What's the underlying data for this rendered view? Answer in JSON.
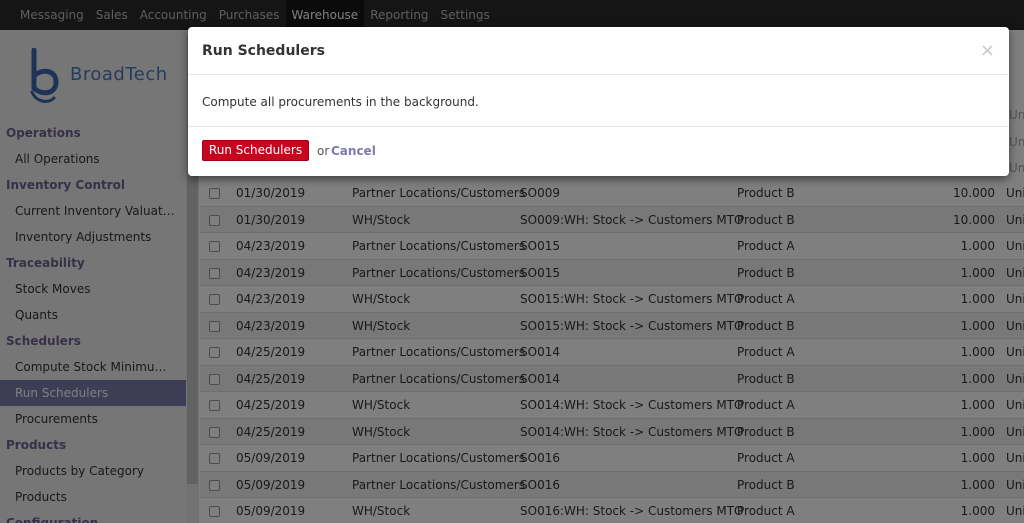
{
  "topbar": {
    "menus": [
      "Messaging",
      "Sales",
      "Accounting",
      "Purchases",
      "Warehouse",
      "Reporting",
      "Settings"
    ],
    "active": "Warehouse"
  },
  "logo": {
    "text": "BroadTech"
  },
  "sidebar": {
    "sections": [
      {
        "title": "Operations",
        "items": [
          "All Operations"
        ]
      },
      {
        "title": "Inventory Control",
        "items": [
          "Current Inventory Valuat…",
          "Inventory Adjustments"
        ]
      },
      {
        "title": "Traceability",
        "items": [
          "Stock Moves",
          "Quants"
        ]
      },
      {
        "title": "Schedulers",
        "items": [
          "Compute Stock Minimu…",
          "Run Schedulers",
          "Procurements"
        ]
      },
      {
        "title": "Products",
        "items": [
          "Products by Category",
          "Products"
        ]
      },
      {
        "title": "Configuration",
        "items": []
      }
    ],
    "active_item": "Run Schedulers"
  },
  "table": {
    "rows": [
      {
        "date": "01/30/2019",
        "location": "Partner Locations/Customers",
        "reference": "SO009",
        "product": "Product B",
        "qty": "10.000",
        "unit": "Uni"
      },
      {
        "date": "01/30/2019",
        "location": "WH/Stock",
        "reference": "SO009:WH: Stock -> Customers MTO",
        "product": "Product B",
        "qty": "10.000",
        "unit": "Uni"
      },
      {
        "date": "04/23/2019",
        "location": "Partner Locations/Customers",
        "reference": "SO015",
        "product": "Product A",
        "qty": "1.000",
        "unit": "Uni"
      },
      {
        "date": "04/23/2019",
        "location": "Partner Locations/Customers",
        "reference": "SO015",
        "product": "Product B",
        "qty": "1.000",
        "unit": "Uni"
      },
      {
        "date": "04/23/2019",
        "location": "WH/Stock",
        "reference": "SO015:WH: Stock -> Customers MTO",
        "product": "Product A",
        "qty": "1.000",
        "unit": "Uni"
      },
      {
        "date": "04/23/2019",
        "location": "WH/Stock",
        "reference": "SO015:WH: Stock -> Customers MTO",
        "product": "Product B",
        "qty": "1.000",
        "unit": "Uni"
      },
      {
        "date": "04/25/2019",
        "location": "Partner Locations/Customers",
        "reference": "SO014",
        "product": "Product A",
        "qty": "1.000",
        "unit": "Uni"
      },
      {
        "date": "04/25/2019",
        "location": "Partner Locations/Customers",
        "reference": "SO014",
        "product": "Product B",
        "qty": "1.000",
        "unit": "Uni"
      },
      {
        "date": "04/25/2019",
        "location": "WH/Stock",
        "reference": "SO014:WH: Stock -> Customers MTO",
        "product": "Product A",
        "qty": "1.000",
        "unit": "Uni"
      },
      {
        "date": "04/25/2019",
        "location": "WH/Stock",
        "reference": "SO014:WH: Stock -> Customers MTO",
        "product": "Product B",
        "qty": "1.000",
        "unit": "Uni"
      },
      {
        "date": "05/09/2019",
        "location": "Partner Locations/Customers",
        "reference": "SO016",
        "product": "Product A",
        "qty": "1.000",
        "unit": "Uni"
      },
      {
        "date": "05/09/2019",
        "location": "Partner Locations/Customers",
        "reference": "SO016",
        "product": "Product B",
        "qty": "1.000",
        "unit": "Uni"
      },
      {
        "date": "05/09/2019",
        "location": "WH/Stock",
        "reference": "SO016:WH: Stock -> Customers MTO",
        "product": "Product A",
        "qty": "1.000",
        "unit": "Uni"
      }
    ],
    "partial_right": [
      "Uni",
      "Uni",
      "Uni"
    ]
  },
  "modal": {
    "title": "Run Schedulers",
    "close_glyph": "×",
    "body": "Compute all procurements in the background.",
    "primary_label": "Run Schedulers",
    "or_text": "or",
    "cancel_label": "Cancel"
  }
}
